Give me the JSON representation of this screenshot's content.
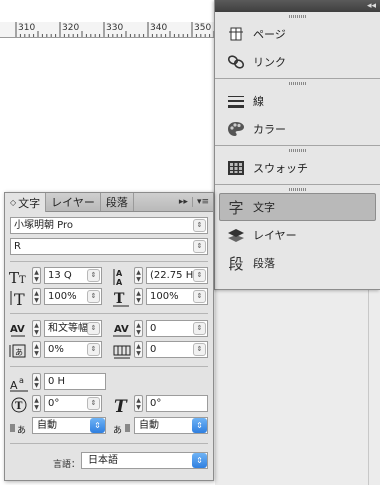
{
  "ruler": {
    "numbers": [
      "310",
      "320",
      "330",
      "340",
      "350"
    ]
  },
  "dock": {
    "collapse_icon": "double-chevron-left",
    "items": [
      {
        "label": "ページ",
        "icon": "pages-icon"
      },
      {
        "label": "リンク",
        "icon": "links-icon"
      },
      {
        "label": "線",
        "icon": "stroke-icon"
      },
      {
        "label": "カラー",
        "icon": "color-icon"
      },
      {
        "label": "スウォッチ",
        "icon": "swatches-icon"
      },
      {
        "label": "文字",
        "icon": "character-icon",
        "active": true
      },
      {
        "label": "レイヤー",
        "icon": "layers-icon"
      },
      {
        "label": "段落",
        "icon": "paragraph-icon"
      }
    ]
  },
  "panel": {
    "tabs": [
      {
        "label": "文字",
        "active": true
      },
      {
        "label": "レイヤー"
      },
      {
        "label": "段落"
      }
    ],
    "font_family": "小塚明朝 Pro",
    "font_style": "R",
    "font_size": "13 Q",
    "leading": "(22.75 H)",
    "vertical_scale": "100%",
    "horizontal_scale": "100%",
    "kerning": "和文等幅",
    "tracking": "0",
    "tsume": "0%",
    "aki": "0",
    "baseline_shift": "0 H",
    "character_rotation": "0°",
    "skew": "0°",
    "aki_before": "自動",
    "aki_after": "自動",
    "language_label": "言語：",
    "language": "日本語"
  },
  "colors": {
    "dock_bg": "#e6e6e6",
    "active_item": "#b9b9b9",
    "select_blue": "#2f7fe0"
  }
}
